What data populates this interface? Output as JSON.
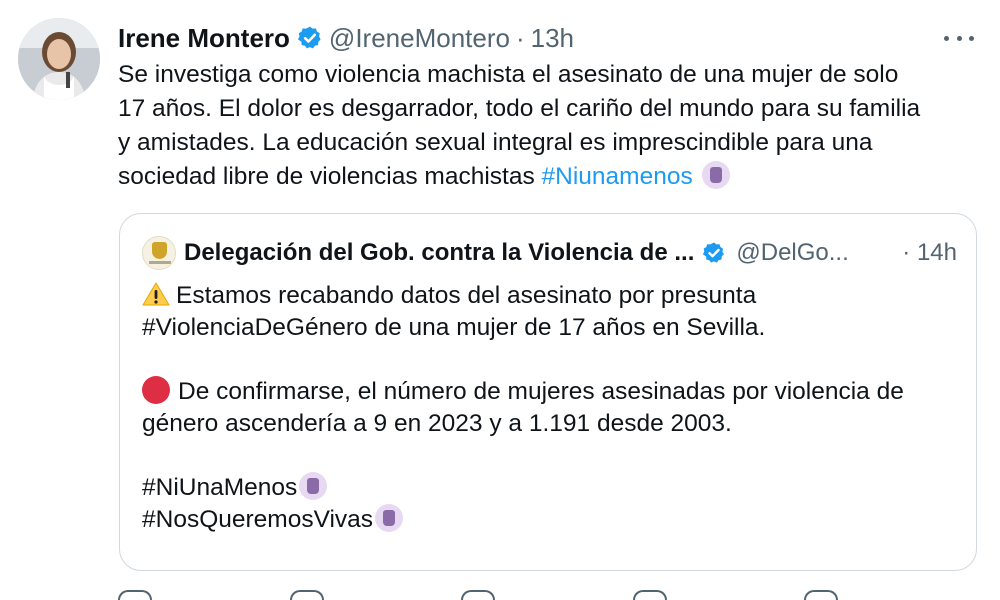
{
  "tweet": {
    "author_name": "Irene Montero",
    "handle": "@IreneMontero",
    "separator": "·",
    "time": "13h",
    "text_line_1": "Se investiga como violencia machista el asesinato de una mujer de solo",
    "text_line_2": "17 años. El dolor es desgarrador, todo el cariño del mundo para su familia",
    "text_line_3": "y amistades. La educación sexual integral es imprescindible para una",
    "text_line_4": "sociedad libre de violencias machistas",
    "hashtag": "#Niunamenos",
    "avatar_icon": "person-photo-icon",
    "verified_icon": "verified-badge-icon",
    "more_icon": "more-options-icon",
    "emoji_icon": "raised-fist-purple-icon"
  },
  "quoted": {
    "author_name": "Delegación del Gob. contra la Violencia de ...",
    "handle": "@DelGo...",
    "time": "· 14h",
    "warning_icon": "warning-icon",
    "red_circle_icon": "red-circle-icon",
    "para1_line1": "Estamos recabando datos del asesinato por presunta",
    "para1_line2": "#ViolenciaDeGénero de una mujer de 17 años en Sevilla.",
    "para2_line1": "De confirmarse, el número de mujeres asesinadas por violencia de",
    "para2_line2": "género ascendería a 9 en 2023 y a 1.191 desde 2003.",
    "hashtag1": "#NiUnaMenos",
    "hashtag2": "#NosQueremosVivas"
  },
  "colors": {
    "link": "#1d9bf0",
    "secondary_text": "#536471",
    "verified": "#1d9bf0",
    "border": "#cfd9de"
  }
}
